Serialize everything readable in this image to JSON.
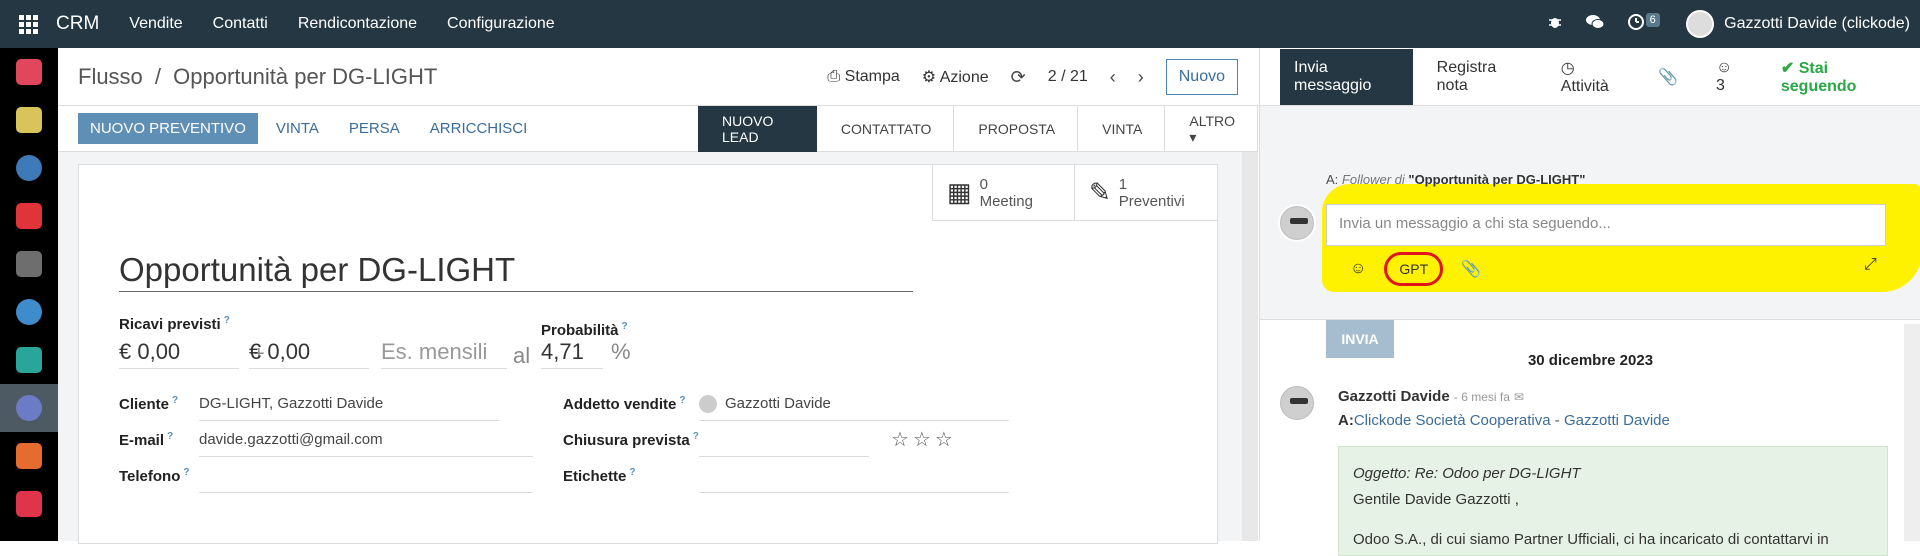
{
  "topbar": {
    "brand": "CRM",
    "menu": [
      "Vendite",
      "Contatti",
      "Rendicontazione",
      "Configurazione"
    ],
    "activity_count": "6",
    "user": "Gazzotti Davide (clickode)"
  },
  "control_panel": {
    "breadcrumb_parent": "Flusso",
    "breadcrumb_sep": "/",
    "breadcrumb_current": "Opportunità per DG-LIGHT",
    "print_label": "Stampa",
    "action_label": "Azione",
    "pager": "2 / 21",
    "new_label": "Nuovo"
  },
  "status_buttons": {
    "new_quote": "NUOVO PREVENTIVO",
    "won": "VINTA",
    "lost": "PERSA",
    "enrich": "ARRICCHISCI"
  },
  "stages": [
    {
      "label": "NUOVO LEAD"
    },
    {
      "label": "CONTATTATO"
    },
    {
      "label": "PROPOSTA"
    },
    {
      "label": "VINTA"
    },
    {
      "label": "ALTRO ▾"
    }
  ],
  "smart_buttons": {
    "meeting_count": "0",
    "meeting_label": "Meeting",
    "quotes_count": "1",
    "quotes_label": "Preventivi"
  },
  "form": {
    "title": "Opportunità per DG-LIGHT",
    "expected_revenue_label": "Ricavi previsti",
    "expected_revenue": "€ 0,00",
    "plus": "+",
    "recurring_revenue": "€ 0,00",
    "recurring_plan": "Es. mensili",
    "at": "al",
    "probability_label": "Probabilità",
    "probability": "4,71",
    "percent": "%",
    "customer_label": "Cliente",
    "customer": "DG-LIGHT, Gazzotti Davide",
    "salesperson_label": "Addetto vendite",
    "salesperson": "Gazzotti Davide",
    "email_label": "E-mail",
    "email": "davide.gazzotti@gmail.com",
    "closing_label": "Chiusura prevista",
    "phone_label": "Telefono",
    "tags_label": "Etichette",
    "help_mark": "?"
  },
  "chatter": {
    "send_message_tab": "Invia messaggio",
    "log_note_tab": "Registra nota",
    "activities_tab": "Attività",
    "followers_count": "3",
    "following_label": "Stai seguendo",
    "to_prefix": "A:",
    "follower_of": "Follower di",
    "record_name": "\"Opportunità per DG-LIGHT\"",
    "input_placeholder": "Invia un messaggio a chi sta seguendo...",
    "gpt_label": "GPT",
    "send_label": "INVIA",
    "date_separator": "30 dicembre 2023",
    "message": {
      "author": "Gazzotti Davide",
      "time": "- 6 mesi fa",
      "to_label": "A:",
      "recipient_1": "Clickode Società Cooperativa",
      "recipient_sep": " - ",
      "recipient_2": "Gazzotti Davide",
      "subject": "Oggetto: Re: Odoo per DG-LIGHT",
      "greeting": "Gentile Davide Gazzotti ,",
      "body": "Odoo S.A., di cui siamo Partner Ufficiali, ci ha incaricato di contattarvi in"
    }
  },
  "colors": {
    "topbar": "#243742",
    "accent": "#5f8fb4",
    "highlight_yellow": "#fff200",
    "highlight_red": "#e0141a"
  }
}
